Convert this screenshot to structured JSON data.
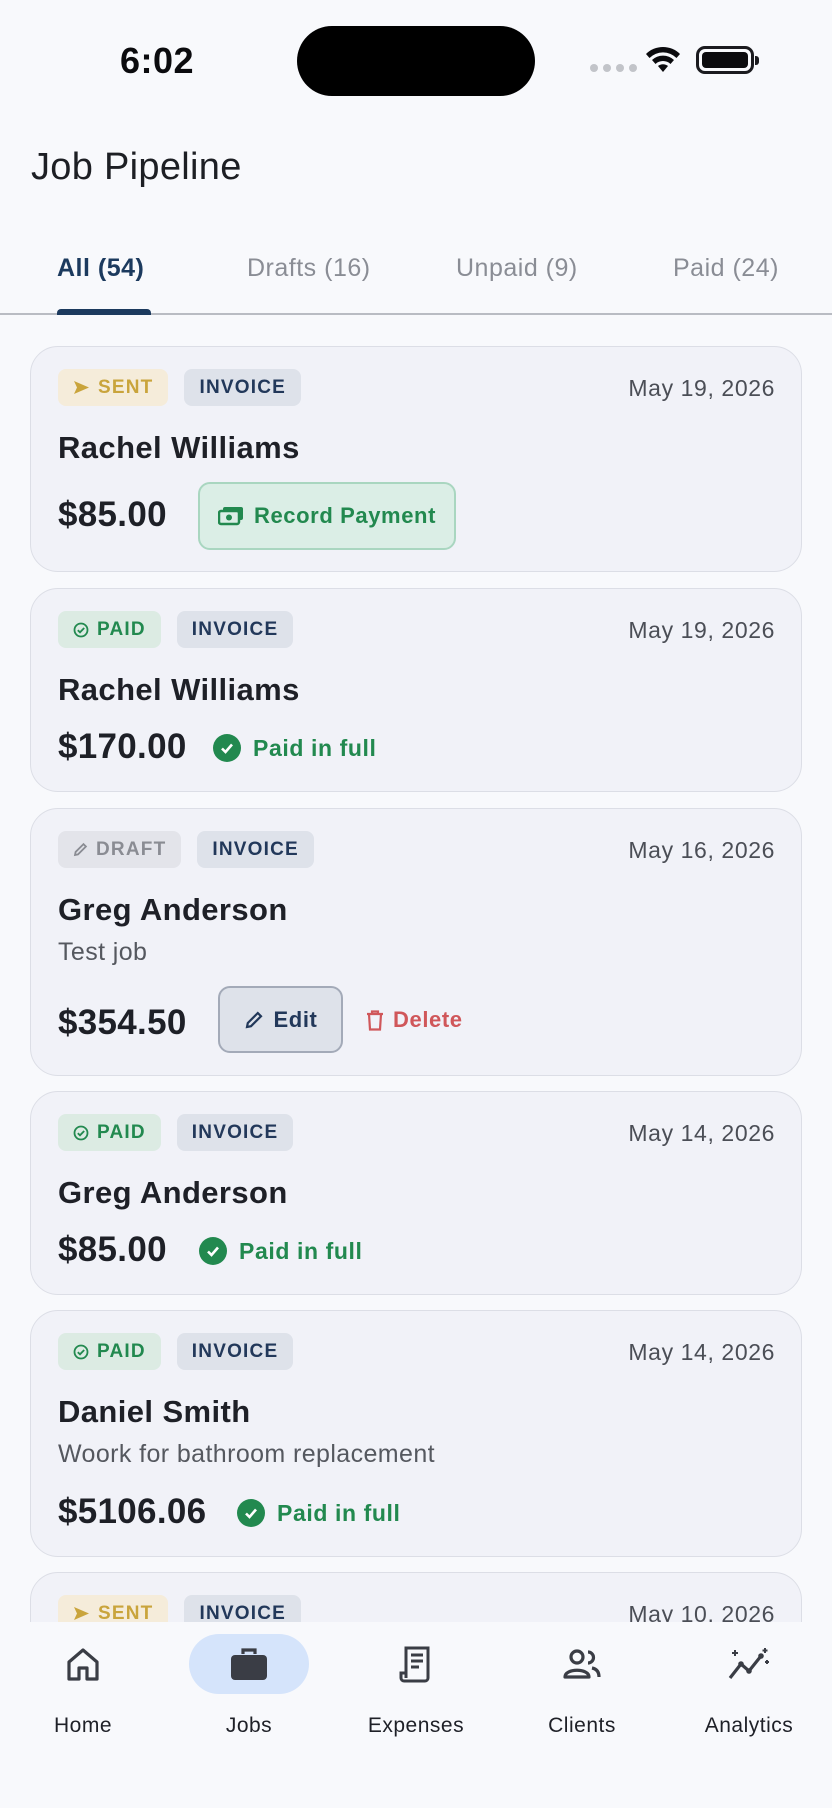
{
  "status_bar": {
    "time": "6:02"
  },
  "header": {
    "title": "Job Pipeline"
  },
  "tabs": [
    {
      "label": "All (54)",
      "active": true
    },
    {
      "label": "Drafts (16)",
      "active": false
    },
    {
      "label": "Unpaid (9)",
      "active": false
    },
    {
      "label": "Paid (24)",
      "active": false
    }
  ],
  "jobs": [
    {
      "status": "SENT",
      "type": "INVOICE",
      "date": "May 19, 2026",
      "client": "Rachel Williams",
      "description": "",
      "amount": "$85.00",
      "action": "Record Payment"
    },
    {
      "status": "PAID",
      "type": "INVOICE",
      "date": "May 19, 2026",
      "client": "Rachel Williams",
      "description": "",
      "amount": "$170.00",
      "paid_label": "Paid in full"
    },
    {
      "status": "DRAFT",
      "type": "INVOICE",
      "date": "May 16, 2026",
      "client": "Greg Anderson",
      "description": "Test job",
      "amount": "$354.50",
      "edit_label": "Edit",
      "delete_label": "Delete"
    },
    {
      "status": "PAID",
      "type": "INVOICE",
      "date": "May 14, 2026",
      "client": "Greg Anderson",
      "description": "",
      "amount": "$85.00",
      "paid_label": "Paid in full"
    },
    {
      "status": "PAID",
      "type": "INVOICE",
      "date": "May 14, 2026",
      "client": "Daniel Smith",
      "description": "Woork for bathroom replacement",
      "amount": "$5106.06",
      "paid_label": "Paid in full"
    },
    {
      "status": "SENT",
      "type": "INVOICE",
      "date": "May 10, 2026"
    }
  ],
  "nav": [
    {
      "label": "Home",
      "icon": "home-icon",
      "active": false
    },
    {
      "label": "Jobs",
      "icon": "briefcase-icon",
      "active": true
    },
    {
      "label": "Expenses",
      "icon": "receipt-icon",
      "active": false
    },
    {
      "label": "Clients",
      "icon": "people-icon",
      "active": false
    },
    {
      "label": "Analytics",
      "icon": "analytics-icon",
      "active": false
    }
  ],
  "colors": {
    "primary": "#1c3a5e",
    "success": "#22894f",
    "warning": "#c9a43c",
    "danger": "#d0575a",
    "nav_active_bg": "#d5e4fb"
  }
}
